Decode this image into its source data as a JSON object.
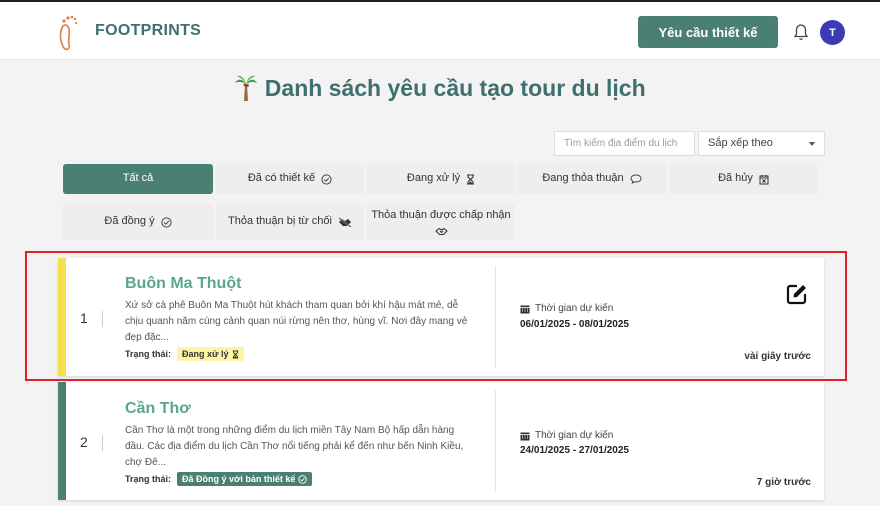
{
  "header": {
    "brand": "FOOTPRINTS",
    "design_button": "Yêu cầu thiết kế",
    "avatar_initial": "T",
    "icons": [
      "footprint-logo-icon",
      "bell-icon"
    ]
  },
  "page": {
    "title": "Danh sách yêu cầu tạo tour du lịch",
    "title_icon": "palm-tree-icon"
  },
  "search": {
    "placeholder": "Tìm kiếm địa điểm du lịch"
  },
  "sort": {
    "label": "Sắp xếp theo"
  },
  "tabs": [
    {
      "label": "Tất cả",
      "icon": "",
      "active": true
    },
    {
      "label": "Đã có thiết kế",
      "icon": "check-circle-icon",
      "active": false
    },
    {
      "label": "Đang xử lý",
      "icon": "hourglass-icon",
      "active": false
    },
    {
      "label": "Đang thỏa thuận",
      "icon": "chat-bubble-icon",
      "active": false
    },
    {
      "label": "Đã hủy",
      "icon": "calendar-x-icon",
      "active": false
    },
    {
      "label": "Đã đồng ý",
      "icon": "check-circle-icon",
      "active": false
    },
    {
      "label": "Thỏa thuận bị từ chối",
      "icon": "handshake-off-icon",
      "active": false
    },
    {
      "label": "Thỏa thuận được chấp nhận",
      "icon": "handshake-icon",
      "active": false
    }
  ],
  "requests": [
    {
      "index": "1",
      "name": "Buôn Ma Thuột",
      "description": "Xứ sở cà phê Buôn Ma Thuột hút khách tham quan bởi khí hậu mát mẻ, dễ chịu quanh năm cùng cảnh quan núi rừng nên thơ, hùng vĩ. Nơi đây mang vẻ đẹp đặc...",
      "status_label": "Trạng thái:",
      "status": "Đang xử lý",
      "status_color": "#fff3a6",
      "stripe_color": "#f5df4d",
      "time_label": "Thời gian dự kiến",
      "dates": "06/01/2025 - 08/01/2025",
      "ago": "vài giây trước",
      "has_edit": true
    },
    {
      "index": "2",
      "name": "Cần Thơ",
      "description": "Cần Thơ là một trong những điểm du lịch miền Tây Nam Bộ hấp dẫn hàng đầu. Các địa điểm du lịch Cần Thơ nổi tiếng phải kể đến như bến Ninh Kiều, chợ Đê...",
      "status_label": "Trạng thái:",
      "status": "Đã Đồng ý với bản thiết kế",
      "status_color": "#4a8074",
      "stripe_color": "#4a8074",
      "time_label": "Thời gian dự kiến",
      "dates": "24/01/2025 - 27/01/2025",
      "ago": "7 giờ trước",
      "has_edit": false
    }
  ],
  "colors": {
    "accent": "#4a8074",
    "title": "#3f6f6f",
    "name": "#5aa58e",
    "highlight": "#e0202a"
  }
}
